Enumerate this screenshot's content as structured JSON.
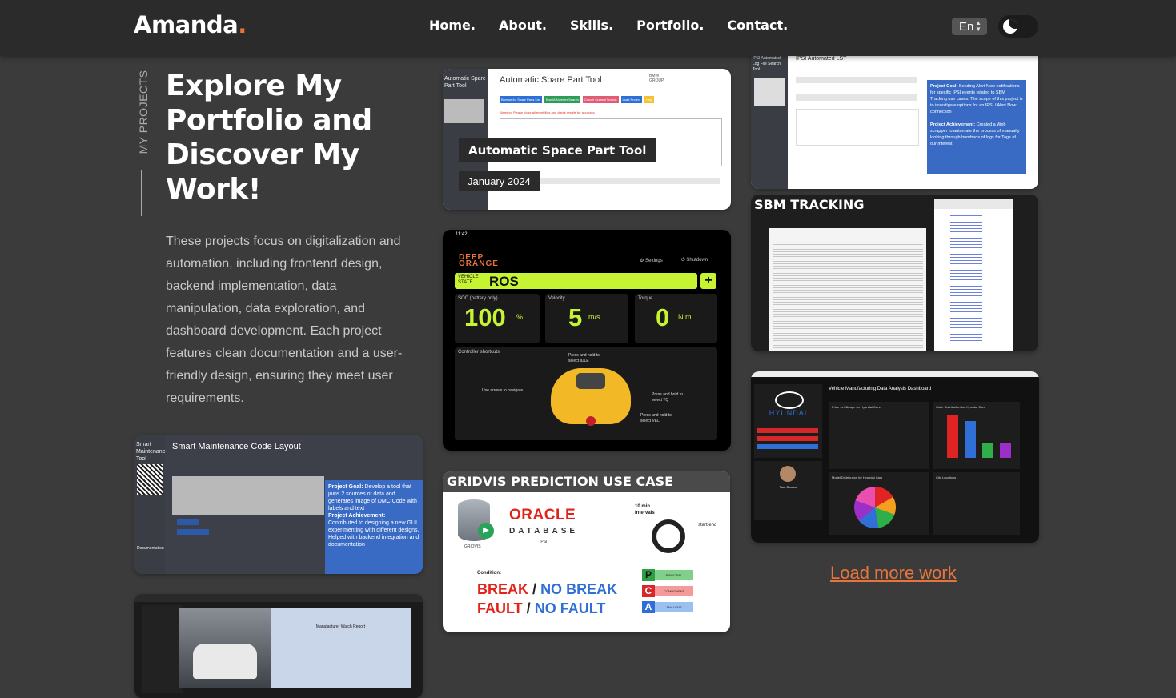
{
  "nav": {
    "logo": "Amanda",
    "logo_dot": ".",
    "items": [
      "Home.",
      "About.",
      "Skills.",
      "Portfolio.",
      "Contact."
    ],
    "language": "En"
  },
  "hero": {
    "vertical_label": "MY PROJECTS",
    "headline": "Explore My Portfolio and Discover My Work!",
    "description": "These projects focus on digitalization and automation, including frontend design, backend implementation, data manipulation, data exploration, and dashboard development. Each project features clean documentation and a user-friendly design, ensuring they meet user requirements."
  },
  "cards": {
    "spare": {
      "title": "Automatic Space Part Tool",
      "date": "January 2024",
      "side_label": "Automatic Spare Part Tool",
      "screen_title": "Automatic Spare Part Tool",
      "brand": "BMW GROUP",
      "buttons": [
        "Browse for Spare Parts List",
        "Run M-Number Search",
        "Cancel Current Search",
        "Load Project",
        "Help"
      ],
      "warning": "Warning: Please close all excel files and check results for accuracy."
    },
    "smart": {
      "side_label": "Smart Maintenance Tool",
      "screen_title": "Smart Maintenance Code Layout",
      "goal_label": "Project Goal:",
      "goal_text": "Develop a tool that joins 2 sources of data and generates image of DMC Code with labels and text",
      "achievement_label": "Project Achievement:",
      "achievement_text": "Contributed to designing a new GUI experimenting with different designs, Helped with backend integration and documentation",
      "documentation": "Documentation"
    },
    "ros": {
      "time": "11:42",
      "brand_top": "DEEP",
      "brand_bottom": "ORANGE",
      "settings": "Settings",
      "shutdown": "Shutdown",
      "vehicle_state_label": "VEHICLE STATE",
      "vehicle_state": "ROS",
      "gauges": [
        {
          "label": "SOC (battery only)",
          "value": "100",
          "unit": "%"
        },
        {
          "label": "Velocity",
          "value": "5",
          "unit": "m/s"
        },
        {
          "label": "Torque",
          "value": "0",
          "unit": "N.m"
        }
      ],
      "shortcuts_label": "Controller shortcuts",
      "hint_idle": "Press and hold to select IDLE",
      "hint_navigate": "Use arrows to navigate",
      "hint_tq": "Press and hold to select TQ",
      "hint_vel": "Press and hold to select VEL"
    },
    "gridvis": {
      "title": "GRIDVIS PREDICTION USE CASE",
      "gridvis_label": "GRIDVIS",
      "oracle": "ORACLE",
      "database": "DATABASE",
      "ipsi": "IPSI",
      "interval": "10 min intervals",
      "startend": "start/end",
      "condition": "Condition:",
      "break": "BREAK",
      "no_break": "NO BREAK",
      "fault": "FAULT",
      "no_fault": "NO FAULT",
      "slash": "/",
      "pca": [
        {
          "letter": "P",
          "word": "PRINCIPAL"
        },
        {
          "letter": "C",
          "word": "COMPONENT"
        },
        {
          "letter": "A",
          "word": "ANALYSIS"
        }
      ]
    },
    "ipsi": {
      "side_label": "IPSI Automated Log File Search Tool",
      "screen_title": "IPSI Automated LST",
      "goal_label": "Project Goal:",
      "goal_text": "Sending Alert Now notifications for specific IPSI events related to SBM Tracking use cases. The scope of this project is to investigate options for an IPSI / Alert Now connection",
      "achievement_label": "Project Achievement:",
      "achievement_text": "Created a Web scrapper to automate the process of manually looking through hundreds of logs for Tags of our interest"
    },
    "sbm": {
      "title": "SBM TRACKING"
    },
    "hyundai": {
      "brand": "HYUNDAI",
      "dash_title": "Vehicle Manufacturing Data Analysis Dashboard",
      "panels": [
        "Price vs Mileage for Hyundai Cars",
        "Color Distribution for Hyundai Cars",
        "Model Distribution for Hyundai Cars",
        "City Locations"
      ],
      "user_name": "Tom Gomez"
    },
    "watch": {
      "title": "Manufacturer Watch Report"
    }
  },
  "load_more": "Load more work",
  "colors": {
    "accent": "#e8743b",
    "background": "#3b3b3b",
    "nav": "#2b2b2b",
    "ros_green": "#c6f432",
    "oracle_red": "#e2231a",
    "pca_green": "#2f9e44",
    "pca_red": "#d62828",
    "pca_blue": "#2f6fd6"
  }
}
